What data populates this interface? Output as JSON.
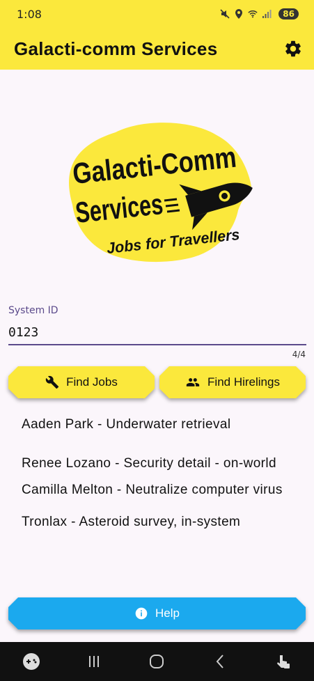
{
  "status_bar": {
    "time": "1:08",
    "battery": "86",
    "icons": [
      "mute-icon",
      "location-icon",
      "wifi-6e-icon",
      "signal-icon"
    ]
  },
  "app_bar": {
    "title": "Galacti-comm Services",
    "settings_icon": "gear-icon"
  },
  "logo": {
    "line1": "Galacti-Comm",
    "line2": "Services",
    "tagline": "Jobs for Travellers",
    "colors": {
      "background": "#fbe83c",
      "text": "#111111"
    }
  },
  "system_id_field": {
    "label": "System ID",
    "value": "0123",
    "counter": "4/4"
  },
  "buttons": {
    "find_jobs": "Find Jobs",
    "find_hirelings": "Find Hirelings",
    "help": "Help"
  },
  "jobs": [
    "Aaden Park - Underwater retrieval",
    "Renee Lozano - Security detail - on-world",
    "Camilla Melton - Neutralize computer virus",
    "Tronlax - Asteroid survey, in-system"
  ],
  "colors": {
    "accent_yellow": "#fbe83c",
    "help_blue": "#1ba9ee",
    "field_purple": "#5b4a8b"
  },
  "nav_bar": {
    "icons": [
      "game-launcher-icon",
      "recents-icon",
      "home-icon",
      "back-icon",
      "touch-lock-icon"
    ]
  }
}
